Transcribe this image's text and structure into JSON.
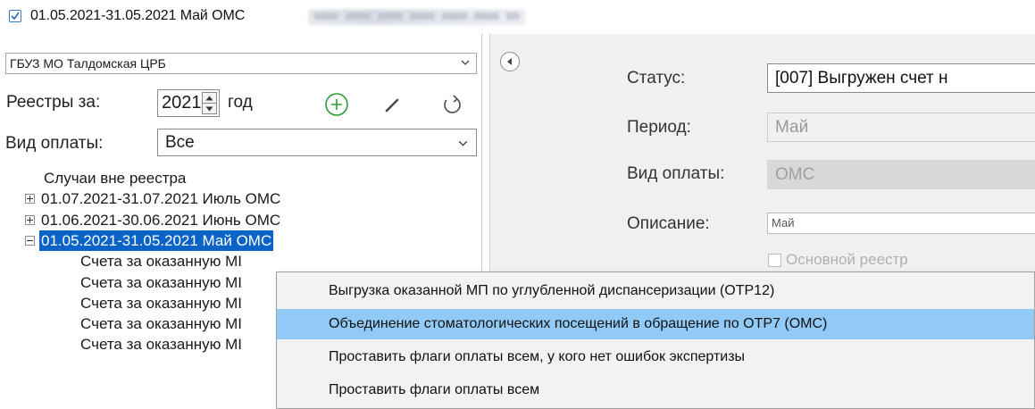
{
  "title": {
    "checked": true,
    "text": "01.05.2021-31.05.2021 Май ОМС"
  },
  "left": {
    "org_select": "ГБУЗ МО Талдомская ЦРБ",
    "registries_label": "Реестры за:",
    "year_value": "2021",
    "year_suffix": "год",
    "payment_label": "Вид оплаты:",
    "payment_value": "Все",
    "tree": [
      {
        "label": "Случаи вне реестра",
        "level": 0,
        "toggle": "none",
        "selected": false
      },
      {
        "label": "01.07.2021-31.07.2021 Июль ОМС",
        "level": 0,
        "toggle": "plus",
        "selected": false
      },
      {
        "label": "01.06.2021-30.06.2021 Июнь ОМС",
        "level": 0,
        "toggle": "plus",
        "selected": false
      },
      {
        "label": "01.05.2021-31.05.2021 Май ОМС",
        "level": 0,
        "toggle": "minus",
        "selected": true
      },
      {
        "label": "Счета за оказанную МІ",
        "level": 1,
        "toggle": "none",
        "selected": false
      },
      {
        "label": "Счета за оказанную МІ",
        "level": 1,
        "toggle": "none",
        "selected": false
      },
      {
        "label": "Счета за оказанную МІ",
        "level": 1,
        "toggle": "none",
        "selected": false
      },
      {
        "label": "Счета за оказанную МІ",
        "level": 1,
        "toggle": "none",
        "selected": false
      },
      {
        "label": "Счета за оказанную МІ",
        "level": 1,
        "toggle": "none",
        "selected": false
      }
    ]
  },
  "right": {
    "status_label": "Статус:",
    "status_value": "[007] Выгружен счет н",
    "period_label": "Период:",
    "period_value": "Май",
    "payment_label": "Вид оплаты:",
    "payment_value": "ОМС",
    "description_label": "Описание:",
    "description_value": "Май",
    "main_registry_label": "Основной реестр"
  },
  "context_menu": {
    "items": [
      {
        "label": "Выгрузка  оказанной МП по углубленной диспансеризации (ОТР12)",
        "highlighted": false
      },
      {
        "label": "Объединение стоматологических посещений в обращение по ОТР7 (ОМС)",
        "highlighted": true
      },
      {
        "label": "Проставить флаги оплаты всем, у кого нет ошибок экспертизы",
        "highlighted": false
      },
      {
        "label": "Проставить флаги оплаты всем",
        "highlighted": false
      }
    ]
  },
  "colors": {
    "selection": "#0a64c8",
    "menu_highlight": "#91c9f7",
    "add_icon": "#2e9a3a"
  }
}
